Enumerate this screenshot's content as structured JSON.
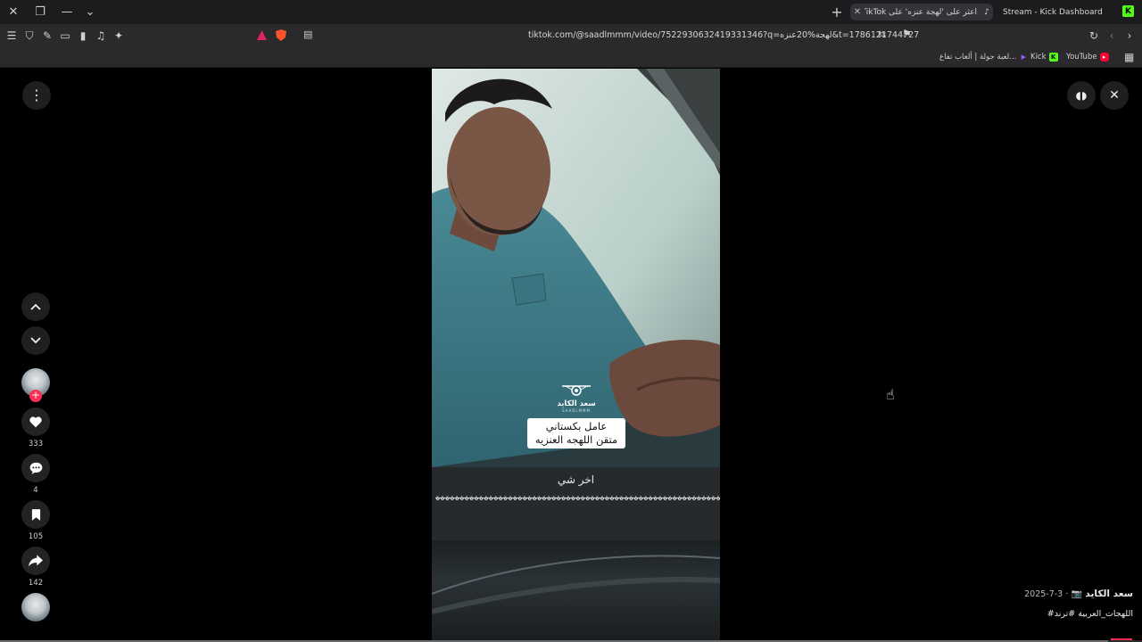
{
  "browser": {
    "tabs": [
      {
        "label": "اعثر على 'لهجة عنزه' على TikTok",
        "active": true
      },
      {
        "label": "Stream - Kick Dashboard",
        "active": false
      }
    ],
    "url": "tiktok.com/@saadlmmm/video/7522930632419331346?q=لهجة%20عنزه&t=1786121744727",
    "bookmarks": [
      {
        "label": "لعبة جولة | ألعاب تفاع...",
        "icon_color": "#9b5cff"
      },
      {
        "label": "Kick",
        "icon_color": "#53fc18"
      },
      {
        "label": "YouTube",
        "icon_color": "#ff0033"
      }
    ]
  },
  "video": {
    "caption_lines": [
      "عامل بكستاني",
      "متقن اللهجه العنزيه"
    ],
    "logo_name": "سعد الكايد",
    "logo_sub": "SAADLMMM",
    "panel_title": "اخر شي",
    "panel_glyphs": "ة‎ة‎ة‎ة‎ة‎ة‎ة‎ة‎ة‎ة‎ة‎ة‎ة‎ة‎ة‎ة‎ة‎ة‎ة‎ة‎ة‎ة‎ة‎ة‎ة‎ة‎ة‎ة‎ة‎ة‎ة‎ة‎ة‎ة‎ة‎ة‎ة‎ة‎ة‎ة‎ة‎ة‎ة‎ة‎ة‎ة‎ة‎ة‎ة‎ة‎ة‎ة‎ة‎ة‎ة‎ة‎ة‎ة‎ة‎ة‎ة‎ة‎ة‎ة‎ة‎ة‎ة‎ة‎ة‎ة‎ة‎ة‎ة‎ة‎ة‎ة‎ة‎ة‎ة‎ة‎ة‎ة‎ة‎ة‎ة‎ة‎ة"
  },
  "stats": {
    "likes": "333",
    "comments": "4",
    "saves": "105",
    "shares": "142"
  },
  "meta": {
    "author": "سعد الكايد",
    "date": "2025-7-3 ·",
    "hashtags": "#اللهجات_العربية #ترند"
  },
  "progress": 0.97
}
